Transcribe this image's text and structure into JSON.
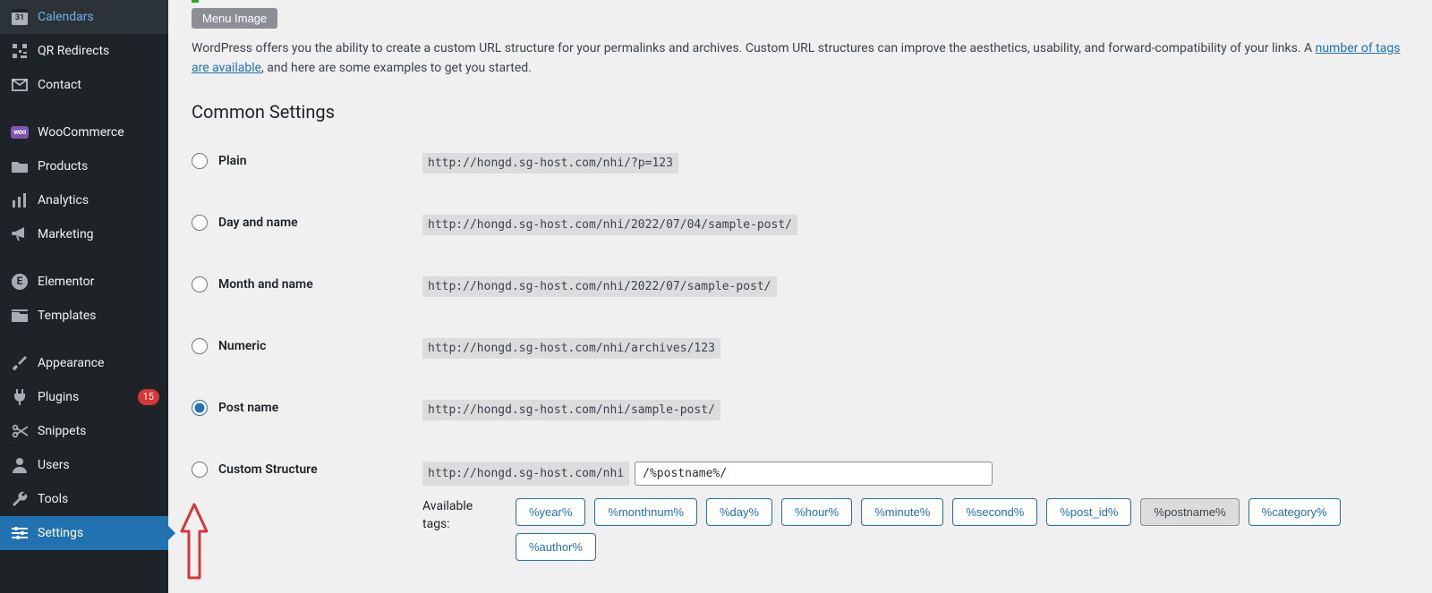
{
  "sidebar": {
    "items": [
      {
        "key": "calendars",
        "label": "Calendars"
      },
      {
        "key": "qrredirects",
        "label": "QR Redirects"
      },
      {
        "key": "contact",
        "label": "Contact"
      },
      {
        "key": "woocommerce",
        "label": "WooCommerce"
      },
      {
        "key": "products",
        "label": "Products"
      },
      {
        "key": "analytics",
        "label": "Analytics"
      },
      {
        "key": "marketing",
        "label": "Marketing"
      },
      {
        "key": "elementor",
        "label": "Elementor"
      },
      {
        "key": "templates",
        "label": "Templates"
      },
      {
        "key": "appearance",
        "label": "Appearance"
      },
      {
        "key": "plugins",
        "label": "Plugins",
        "badge": "15"
      },
      {
        "key": "snippets",
        "label": "Snippets"
      },
      {
        "key": "users",
        "label": "Users"
      },
      {
        "key": "tools",
        "label": "Tools"
      },
      {
        "key": "settings",
        "label": "Settings"
      }
    ],
    "calendar_day": "31"
  },
  "menu_image_button": "Menu Image",
  "intro": {
    "text_before_link": "WordPress offers you the ability to create a custom URL structure for your permalinks and archives. Custom URL structures can improve the aesthetics, usability, and forward-compatibility of your links. A ",
    "link_text": "number of tags are available",
    "text_after_link": ", and here are some examples to get you started."
  },
  "section_title": "Common Settings",
  "options": {
    "plain": {
      "label": "Plain",
      "url": "http://hongd.sg-host.com/nhi/?p=123"
    },
    "dayname": {
      "label": "Day and name",
      "url": "http://hongd.sg-host.com/nhi/2022/07/04/sample-post/"
    },
    "monthname": {
      "label": "Month and name",
      "url": "http://hongd.sg-host.com/nhi/2022/07/sample-post/"
    },
    "numeric": {
      "label": "Numeric",
      "url": "http://hongd.sg-host.com/nhi/archives/123"
    },
    "postname": {
      "label": "Post name",
      "url": "http://hongd.sg-host.com/nhi/sample-post/"
    },
    "custom": {
      "label": "Custom Structure",
      "prefix": "http://hongd.sg-host.com/nhi",
      "value": "/%postname%/"
    }
  },
  "selected_option": "postname",
  "available_label": "Available tags:",
  "tags": [
    "%year%",
    "%monthnum%",
    "%day%",
    "%hour%",
    "%minute%",
    "%second%",
    "%post_id%",
    "%postname%",
    "%category%",
    "%author%"
  ],
  "active_tag": "%postname%"
}
